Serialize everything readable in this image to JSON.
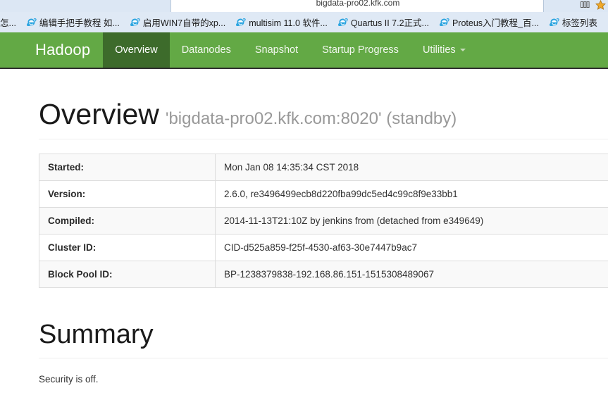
{
  "browser": {
    "url": "bigdata-pro02.kfk.com",
    "right_icons": [
      {
        "name": "reading-view-icon",
        "glyph": "☷"
      },
      {
        "name": "favorites-star-icon",
        "glyph": "★"
      }
    ],
    "bookmarks": [
      {
        "name": "bookmark-clipped",
        "label": "怎...",
        "icon": "ie-icon",
        "clipped": true
      },
      {
        "name": "bookmark-bianji-shoubashou",
        "label": "编辑手把手教程 如...",
        "icon": "ie-icon"
      },
      {
        "name": "bookmark-win7-xp",
        "label": "启用WIN7自带的xp...",
        "icon": "ie-icon"
      },
      {
        "name": "bookmark-multisim",
        "label": "multisim 11.0 软件...",
        "icon": "ie-icon"
      },
      {
        "name": "bookmark-quartus",
        "label": "Quartus II 7.2正式...",
        "icon": "ie-icon"
      },
      {
        "name": "bookmark-proteus",
        "label": "Proteus入门教程_百...",
        "icon": "ie-icon"
      },
      {
        "name": "bookmark-biaoqianlie",
        "label": "标签列表",
        "icon": "ie-icon"
      }
    ]
  },
  "navbar": {
    "brand": "Hadoop",
    "brand_color": "#63a945",
    "active_color": "#3d6b2b",
    "items": [
      {
        "name": "nav-overview",
        "label": "Overview",
        "active": true,
        "caret": false
      },
      {
        "name": "nav-datanodes",
        "label": "Datanodes",
        "active": false,
        "caret": false
      },
      {
        "name": "nav-snapshot",
        "label": "Snapshot",
        "active": false,
        "caret": false
      },
      {
        "name": "nav-startup-progress",
        "label": "Startup Progress",
        "active": false,
        "caret": false
      },
      {
        "name": "nav-utilities",
        "label": "Utilities",
        "active": false,
        "caret": true
      }
    ]
  },
  "page": {
    "title": "Overview",
    "subtitle": "'bigdata-pro02.kfk.com:8020' (standby)",
    "table": [
      {
        "label": "Started:",
        "value": "Mon Jan 08 14:35:34 CST 2018"
      },
      {
        "label": "Version:",
        "value": "2.6.0, re3496499ecb8d220fba99dc5ed4c99c8f9e33bb1"
      },
      {
        "label": "Compiled:",
        "value": "2014-11-13T21:10Z by jenkins from (detached from e349649)"
      },
      {
        "label": "Cluster ID:",
        "value": "CID-d525a859-f25f-4530-af63-30e7447b9ac7"
      },
      {
        "label": "Block Pool ID:",
        "value": "BP-1238379838-192.168.86.151-1515308489067"
      }
    ],
    "summary_title": "Summary",
    "security_text": "Security is off."
  }
}
